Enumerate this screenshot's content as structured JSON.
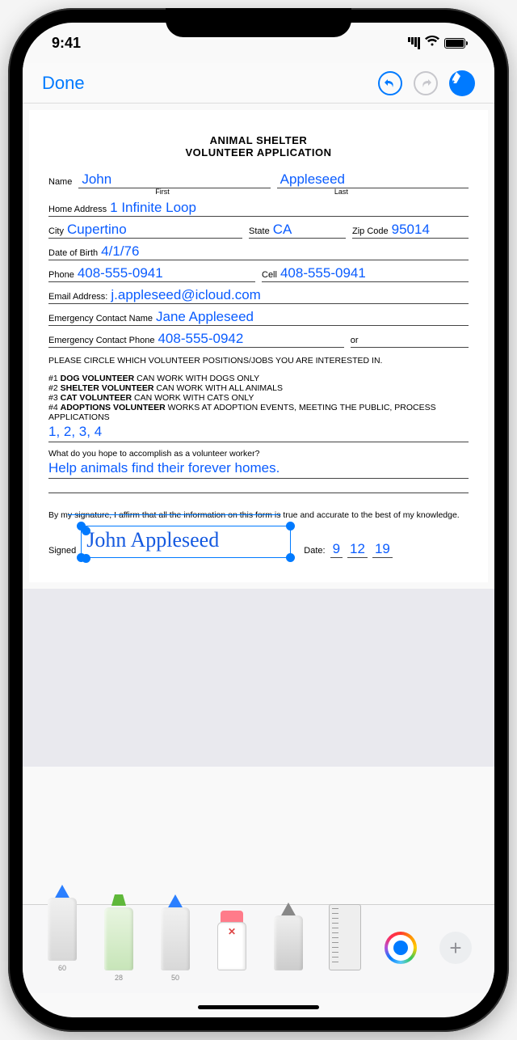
{
  "status": {
    "time": "9:41"
  },
  "nav": {
    "done": "Done"
  },
  "doc": {
    "title_l1": "ANIMAL SHELTER",
    "title_l2": "VOLUNTEER APPLICATION",
    "labels": {
      "name": "Name",
      "first": "First",
      "last": "Last",
      "home_address": "Home Address",
      "city": "City",
      "state": "State",
      "zip": "Zip Code",
      "dob": "Date of Birth",
      "phone": "Phone",
      "cell": "Cell",
      "email": "Email Address:",
      "ec_name": "Emergency Contact Name",
      "ec_phone": "Emergency Contact Phone",
      "or": "or",
      "signed": "Signed",
      "date": "Date:"
    },
    "values": {
      "first_name": "John",
      "last_name": "Appleseed",
      "address": "1 Infinite Loop",
      "city": "Cupertino",
      "state": "CA",
      "zip": "95014",
      "dob": "4/1/76",
      "phone": "408-555-0941",
      "cell": "408-555-0941",
      "email": "j.appleseed@icloud.com",
      "ec_name": "Jane Appleseed",
      "ec_phone": "408-555-0942",
      "choices": "1, 2, 3, 4",
      "answer": "Help animals find their forever homes.",
      "signature_name": "John Appleseed",
      "date_m": "9",
      "date_d": "12",
      "date_y": "19"
    },
    "instructions": "PLEASE CIRCLE WHICH VOLUNTEER POSITIONS/JOBS YOU ARE INTERESTED IN.",
    "positions": {
      "p1n": "#1",
      "p1b": "DOG VOLUNTEER",
      "p1t": " CAN WORK WITH DOGS ONLY",
      "p2n": "#2",
      "p2b": "SHELTER VOLUNTEER",
      "p2t": " CAN WORK WITH ALL ANIMALS",
      "p3n": "#3",
      "p3b": "CAT VOLUNTEER",
      "p3t": " CAN WORK WITH CATS ONLY",
      "p4n": "#4",
      "p4b": "ADOPTIONS VOLUNTEER",
      "p4t": " WORKS AT ADOPTION EVENTS, MEETING THE PUBLIC, PROCESS APPLICATIONS"
    },
    "question": "What do you hope to accomplish as a volunteer worker?",
    "affirm_pre": "By m",
    "affirm_strike": "y signature, I affirm that all the information on this form is",
    "affirm_post": " true and accurate to the best of my knowledge."
  },
  "tools": {
    "pen_size": "60",
    "marker_size": "28",
    "pencil_size": "50"
  }
}
